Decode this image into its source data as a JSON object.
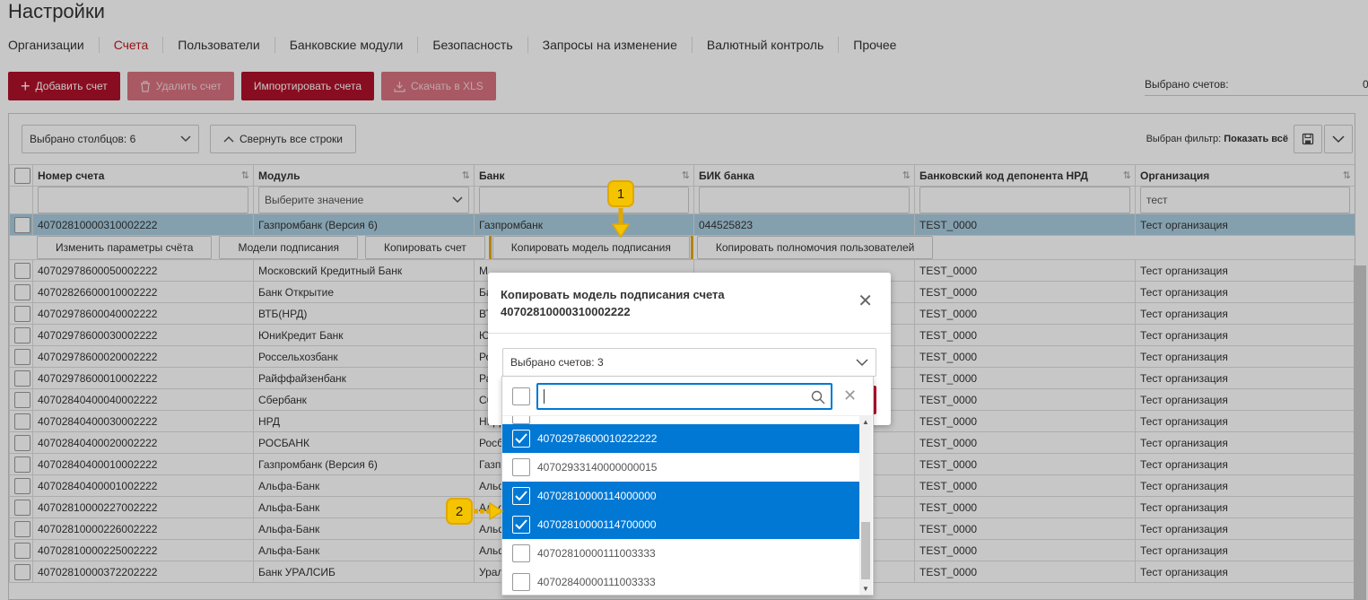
{
  "page": {
    "title": "Настройки"
  },
  "tabs": [
    "Организации",
    "Счета",
    "Пользователи",
    "Банковские модули",
    "Безопасность",
    "Запросы на изменение",
    "Валютный контроль",
    "Прочее"
  ],
  "active_tab": "Счета",
  "toolbar": {
    "add": "Добавить счет",
    "delete": "Удалить счет",
    "import": "Импортировать счета",
    "download": "Скачать в XLS",
    "selected_label": "Выбрано счетов:",
    "selected_value": "0"
  },
  "grid": {
    "columns_select": "Выбрано столбцов: 6",
    "collapse": "Свернуть все строки",
    "filter_prefix": "Выбран фильтр:",
    "filter_value": "Показать всё",
    "headers": [
      "Номер счета",
      "Модуль",
      "Банк",
      "БИК банка",
      "Банковский код депонента НРД",
      "Организация"
    ],
    "filters": {
      "module_placeholder": "Выберите значение",
      "org": "тест"
    },
    "selected_row": {
      "account": "40702810000310002222",
      "module": "Газпромбанк (Версия 6)",
      "bank": "Газпромбанк",
      "bik": "044525823",
      "nrd": "TEST_0000",
      "org": "Тест организация"
    },
    "row_actions": [
      "Изменить параметры счёта",
      "Модели подписания",
      "Копировать счет",
      "Копировать модель подписания",
      "Копировать полномочия пользователей"
    ],
    "rows": [
      {
        "account": "40702978600050002222",
        "module": "Московский Кредитный Банк",
        "bank": "М",
        "nrd": "TEST_0000",
        "org": "Тест организация"
      },
      {
        "account": "40702826600010002222",
        "module": "Банк Открытие",
        "bank": "Ба",
        "nrd": "TEST_0000",
        "org": "Тест организация"
      },
      {
        "account": "40702978600040002222",
        "module": "ВТБ(НРД)",
        "bank": "ВТ",
        "nrd": "TEST_0000",
        "org": "Тест организация"
      },
      {
        "account": "40702978600030002222",
        "module": "ЮниКредит Банк",
        "bank": "Ю",
        "nrd": "TEST_0000",
        "org": "Тест организация"
      },
      {
        "account": "40702978600020002222",
        "module": "Россельхозбанк",
        "bank": "Ро",
        "nrd": "TEST_0000",
        "org": "Тест организация"
      },
      {
        "account": "40702978600010002222",
        "module": "Райффайзенбанк",
        "bank": "Ра",
        "nrd": "TEST_0000",
        "org": "Тест организация"
      },
      {
        "account": "40702840400040002222",
        "module": "Сбербанк",
        "bank": "Сб",
        "nrd": "TEST_0000",
        "org": "Тест организация"
      },
      {
        "account": "40702840400030002222",
        "module": "НРД",
        "bank": "НРД",
        "nrd": "TEST_0000",
        "org": "Тест организация"
      },
      {
        "account": "40702840400020002222",
        "module": "РОСБАНК",
        "bank": "Росб",
        "nrd": "TEST_0000",
        "org": "Тест организация"
      },
      {
        "account": "40702840400010002222",
        "module": "Газпромбанк (Версия 6)",
        "bank": "Газп",
        "nrd": "TEST_0000",
        "org": "Тест организация"
      },
      {
        "account": "40702840400001002222",
        "module": "Альфа-Банк",
        "bank": "Альф",
        "nrd": "TEST_0000",
        "org": "Тест организация"
      },
      {
        "account": "40702810000227002222",
        "module": "Альфа-Банк",
        "bank": "Альф",
        "nrd": "TEST_0000",
        "org": "Тест организация"
      },
      {
        "account": "40702810000226002222",
        "module": "Альфа-Банк",
        "bank": "Альф",
        "nrd": "TEST_0000",
        "org": "Тест организация"
      },
      {
        "account": "40702810000225002222",
        "module": "Альфа-Банк",
        "bank": "Альф",
        "nrd": "TEST_0000",
        "org": "Тест организация"
      },
      {
        "account": "40702810000372202222",
        "module": "Банк УРАЛСИБ",
        "bank": "Урал",
        "nrd": "TEST_0000",
        "org": "Тест организация"
      }
    ]
  },
  "dialog": {
    "title": "Копировать модель подписания счета 40702810000310002222",
    "select_value": "Выбрано счетов: 3",
    "search_value": "",
    "options": [
      {
        "label": "40702978600010222222",
        "checked": true
      },
      {
        "label": "40702933140000000015",
        "checked": false
      },
      {
        "label": "40702810000114000000",
        "checked": true
      },
      {
        "label": "40702810000114700000",
        "checked": true
      },
      {
        "label": "40702810000111003333",
        "checked": false
      },
      {
        "label": "40702840000111003333",
        "checked": false
      }
    ]
  },
  "badges": {
    "one": "1",
    "two": "2"
  },
  "colors": {
    "brand_red": "#b0112a",
    "selected_blue": "#0078d4",
    "row_highlight": "#a9cde0",
    "annotation_yellow": "#f5c400"
  }
}
